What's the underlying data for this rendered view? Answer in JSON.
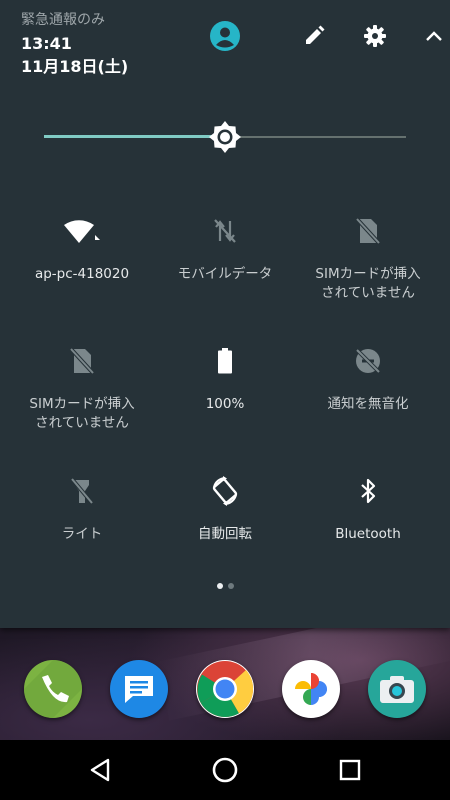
{
  "status": {
    "carrier": "緊急通報のみ",
    "time": "13:41",
    "date": "11月18日(土)"
  },
  "header_icons": [
    "account-icon",
    "pencil-edit-icon",
    "gear-icon",
    "chevron-up-icon"
  ],
  "brightness": {
    "level": 0.5
  },
  "tiles": [
    {
      "label": "ap-pc-418020",
      "icon": "wifi-icon",
      "active": true
    },
    {
      "label": "モバイルデータ",
      "icon": "mobile-data-off-icon",
      "active": false
    },
    {
      "label": "SIMカードが挿入\nされていません",
      "icon": "no-sim-icon",
      "active": false
    },
    {
      "label": "SIMカードが挿入\nされていません",
      "icon": "no-sim-icon",
      "active": false
    },
    {
      "label": "100%",
      "icon": "battery-icon",
      "active": true
    },
    {
      "label": "通知を無音化",
      "icon": "do-not-disturb-off-icon",
      "active": false
    },
    {
      "label": "ライト",
      "icon": "flashlight-off-icon",
      "active": false
    },
    {
      "label": "自動回転",
      "icon": "auto-rotate-icon",
      "active": true
    },
    {
      "label": "Bluetooth",
      "icon": "bluetooth-icon",
      "active": true
    }
  ],
  "pages": {
    "count": 2,
    "current": 1
  },
  "dock": [
    "phone-app-icon",
    "messages-app-icon",
    "chrome-app-icon",
    "photos-app-icon",
    "camera-app-icon"
  ],
  "navbar": [
    "back-icon",
    "home-icon",
    "recents-icon"
  ],
  "colors": {
    "panel": "#263238",
    "accent": "#80cbc4",
    "avatar": "#26b5c7"
  }
}
